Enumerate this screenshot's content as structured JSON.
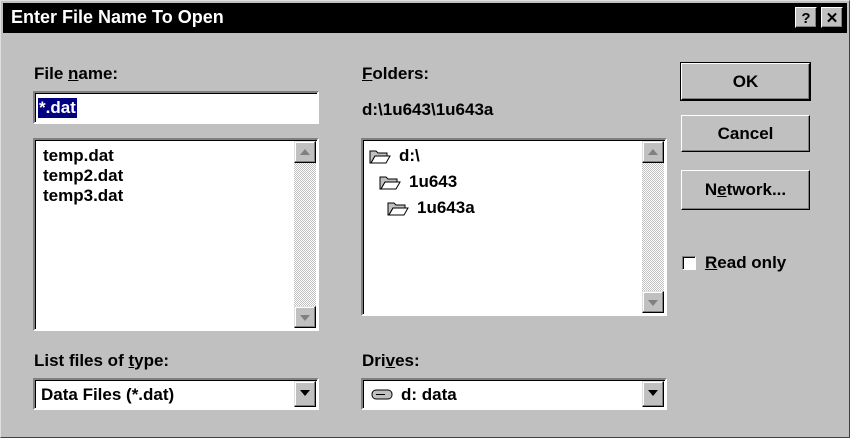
{
  "window": {
    "title": "Enter File Name To Open",
    "help_button": "?",
    "close_button": "✕"
  },
  "file_name": {
    "label_pre": "File ",
    "label_key": "n",
    "label_post": "ame:",
    "value": "*.dat",
    "files": [
      "temp.dat",
      "temp2.dat",
      "temp3.dat"
    ]
  },
  "folders": {
    "label_key": "F",
    "label_post": "olders:",
    "current_path": "d:\\1u643\\1u643a",
    "items": [
      "d:\\",
      "1u643",
      "1u643a"
    ]
  },
  "file_type": {
    "label_pre": "List files of ",
    "label_key": "t",
    "label_post": "ype:",
    "selected": "Data Files (*.dat)"
  },
  "drives": {
    "label_pre": "Dri",
    "label_key": "v",
    "label_post": "es:",
    "selected": "d: data"
  },
  "buttons": {
    "ok": "OK",
    "cancel": "Cancel",
    "network_pre": "N",
    "network_key": "e",
    "network_post": "twork..."
  },
  "read_only": {
    "label_key": "R",
    "label_post": "ead only",
    "checked": false
  }
}
